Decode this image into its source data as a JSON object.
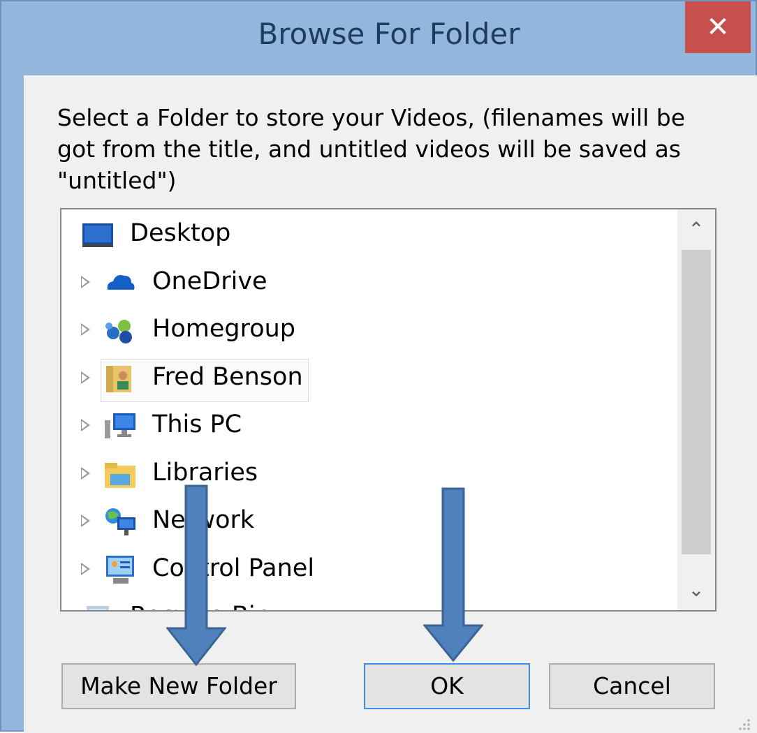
{
  "window": {
    "title": "Browse For Folder",
    "close_glyph": "✕",
    "title_color": "#93b6dd",
    "close_color": "#c7504e"
  },
  "instruction": "Select a Folder to store your Videos, (filenames will be got from the title, and untitled videos will be saved as \"untitled\")",
  "tree": {
    "items": [
      {
        "label": "Desktop",
        "icon": "desktop-icon",
        "expandable": false,
        "selected": false
      },
      {
        "label": "OneDrive",
        "icon": "onedrive-cloud-icon",
        "expandable": true,
        "selected": false
      },
      {
        "label": "Homegroup",
        "icon": "homegroup-icon",
        "expandable": true,
        "selected": false
      },
      {
        "label": "Fred Benson",
        "icon": "user-folder-icon",
        "expandable": true,
        "selected": true
      },
      {
        "label": "This PC",
        "icon": "this-pc-icon",
        "expandable": true,
        "selected": false
      },
      {
        "label": "Libraries",
        "icon": "libraries-icon",
        "expandable": true,
        "selected": false
      },
      {
        "label": "Network",
        "icon": "network-icon",
        "expandable": true,
        "selected": false
      },
      {
        "label": "Control Panel",
        "icon": "control-panel-icon",
        "expandable": true,
        "selected": false
      },
      {
        "label": "Recycle Bin",
        "icon": "recycle-bin-icon",
        "expandable": false,
        "selected": false
      }
    ],
    "scroll_up_glyph": "⌃",
    "scroll_down_glyph": "⌄"
  },
  "buttons": {
    "make_new_folder": "Make New Folder",
    "ok": "OK",
    "cancel": "Cancel"
  },
  "annotations": {
    "arrow_color": "#4f81bd",
    "arrow_targets": [
      "Make New Folder",
      "OK"
    ]
  }
}
